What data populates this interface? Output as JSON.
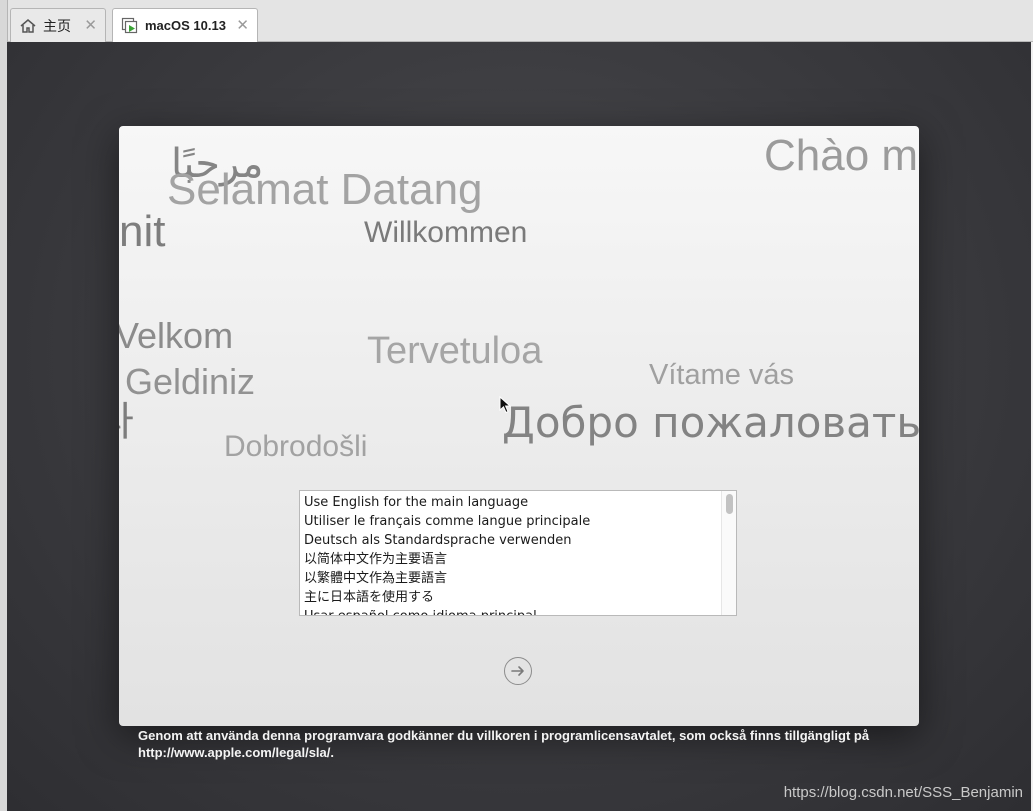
{
  "tabs": [
    {
      "label": "主页",
      "icon": "home-icon"
    },
    {
      "label": "macOS 10.13",
      "icon": "vm-running-icon"
    }
  ],
  "greetings": {
    "marhaban": "مرحبًا",
    "selamat": "Selamat Datang",
    "chao": "Chào m",
    "nit": "nit",
    "willkommen": "Willkommen",
    "velkom": "Velkom",
    "tervetuloa": "Tervetuloa",
    "vitame": "Vítame vás",
    "geldiniz": "Geldiniz",
    "korean_frag": "다",
    "dobrodosli": "Dobrodošli",
    "dobro": "Добро пожаловать"
  },
  "language_list": [
    "Use English for the main language",
    "Utiliser le français comme langue principale",
    "Deutsch als Standardsprache verwenden",
    "以简体中文作为主要语言",
    "以繁體中文作為主要語言",
    "主に日本語を使用する",
    "Usar español como idioma principal"
  ],
  "next_button_icon": "arrow-right-circle-icon",
  "license_text": "Genom att använda denna programvara godkänner du villkoren i programlicensavtalet, som också finns tillgängligt på http://www.apple.com/legal/sla/.",
  "watermark": "https://blog.csdn.net/SSS_Benjamin",
  "colors": {
    "vm_background": "#3a3a3e",
    "window_background": "#ececec",
    "greeting_text": "#8a8a8a",
    "vm_icon_accent": "#3aa335"
  }
}
